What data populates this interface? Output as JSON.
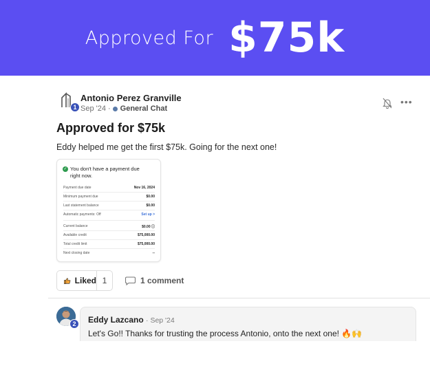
{
  "banner": {
    "prefix": "Approved For",
    "amount": "$75k",
    "color": "#5b4ef2"
  },
  "post": {
    "author": "Antonio Perez Granville",
    "level": "1",
    "date": "Sep '24",
    "separator": "·",
    "channel": "General Chat",
    "title": "Approved for $75k",
    "body": "Eddy helped me get the first $75k. Going for the next one!",
    "icons": {
      "notification": "bell-off-icon",
      "menu": "more-horizontal-icon"
    }
  },
  "card": {
    "headline": "You don't have a payment due right now.",
    "rows": [
      {
        "label": "Payment due date",
        "value": "Nov 16, 2024"
      },
      {
        "label": "Minimum payment due",
        "value": "$0.00"
      },
      {
        "label": "Last statement balance",
        "value": "$0.00"
      },
      {
        "label": "Automatic payments: Off",
        "value": "Set up >"
      },
      {
        "label": "Current balance",
        "value": "$0.00 ⓘ"
      },
      {
        "label": "Available credit",
        "value": "$75,000.00"
      },
      {
        "label": "Total credit limit",
        "value": "$75,000.00"
      },
      {
        "label": "Next closing date",
        "value": "--"
      }
    ]
  },
  "actions": {
    "liked_label": "Liked",
    "liked_count": "1",
    "comment_label": "1 comment"
  },
  "comment": {
    "author": "Eddy Lazcano",
    "date": "· Sep '24",
    "level": "2",
    "text": "Let's Go!! Thanks for trusting the process Antonio, onto the next one! 🔥🙌"
  }
}
